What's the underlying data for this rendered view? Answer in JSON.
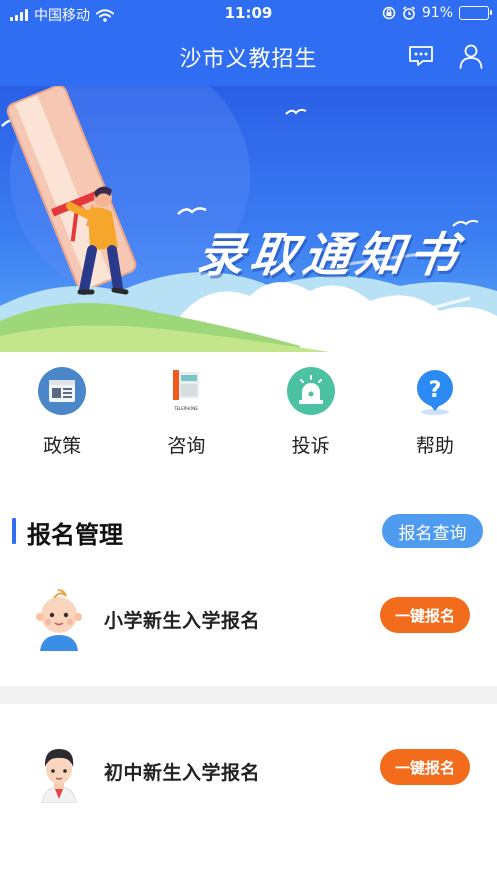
{
  "status_bar": {
    "carrier": "中国移动",
    "time": "11:09",
    "battery": "91%",
    "battery_level": 0.91
  },
  "nav": {
    "title": "沙市义教招生",
    "icons": [
      "message-icon",
      "user-icon"
    ]
  },
  "banner": {
    "text": "录取通知书"
  },
  "quick_menu": [
    {
      "label": "政策",
      "icon": "policy-icon"
    },
    {
      "label": "咨询",
      "icon": "telephone-icon",
      "icon_caption": "TELEPHONE"
    },
    {
      "label": "投诉",
      "icon": "alarm-icon"
    },
    {
      "label": "帮助",
      "icon": "help-icon"
    }
  ],
  "registration": {
    "title": "报名管理",
    "query_label": "报名查询",
    "items": [
      {
        "name": "小学新生入学报名",
        "button": "一键报名",
        "icon": "baby-avatar-icon"
      },
      {
        "name": "初中新生入学报名",
        "button": "一键报名",
        "icon": "student-avatar-icon"
      }
    ]
  },
  "colors": {
    "primary": "#2f6df3",
    "query_button": "#4f9bf0",
    "register_button": "#f36c1b",
    "divider": "#f2f2f2"
  }
}
